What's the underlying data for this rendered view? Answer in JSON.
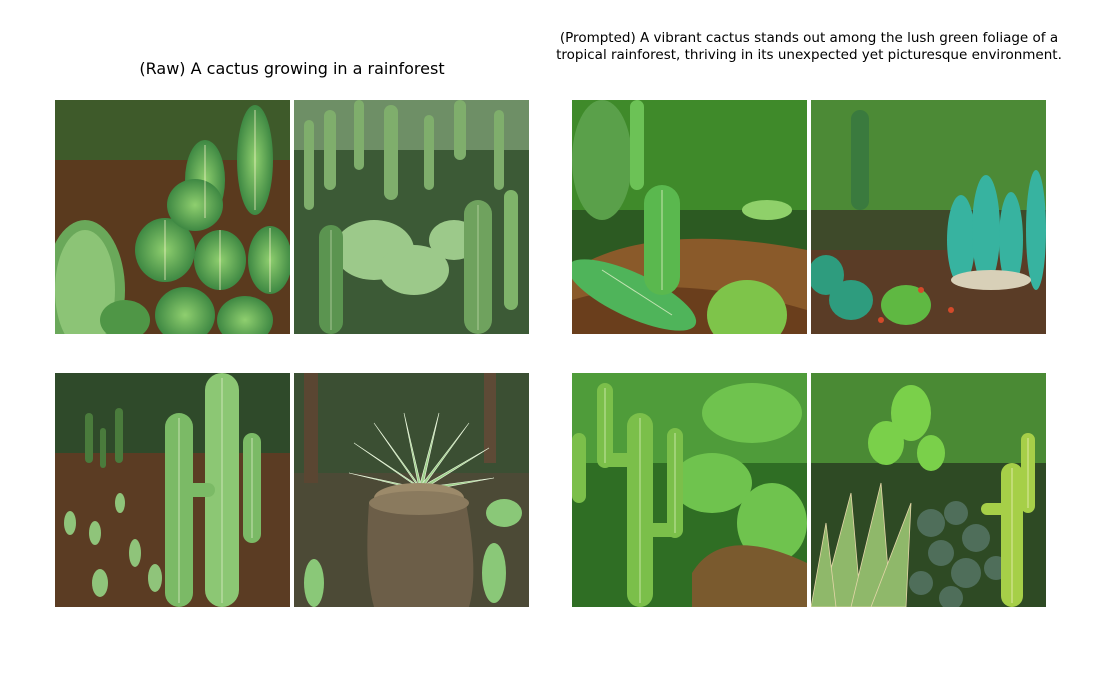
{
  "panels": [
    {
      "title": "(Raw) A cactus growing in a rainforest",
      "images": [
        {
          "description_icon": "cactus-closeup-photo"
        },
        {
          "description_icon": "cactus-field-photo"
        },
        {
          "description_icon": "tall-cactus-dirt-photo"
        },
        {
          "description_icon": "agave-stump-photo"
        }
      ]
    },
    {
      "title": "(Prompted) A vibrant cactus stands out among the lush green foliage of a tropical rainforest, thriving in its unexpected yet picturesque environment.",
      "images": [
        {
          "description_icon": "cactus-hillside-photo"
        },
        {
          "description_icon": "succulent-garden-photo"
        },
        {
          "description_icon": "saguaro-jungle-photo"
        },
        {
          "description_icon": "prickly-pear-rocks-photo"
        }
      ]
    }
  ]
}
